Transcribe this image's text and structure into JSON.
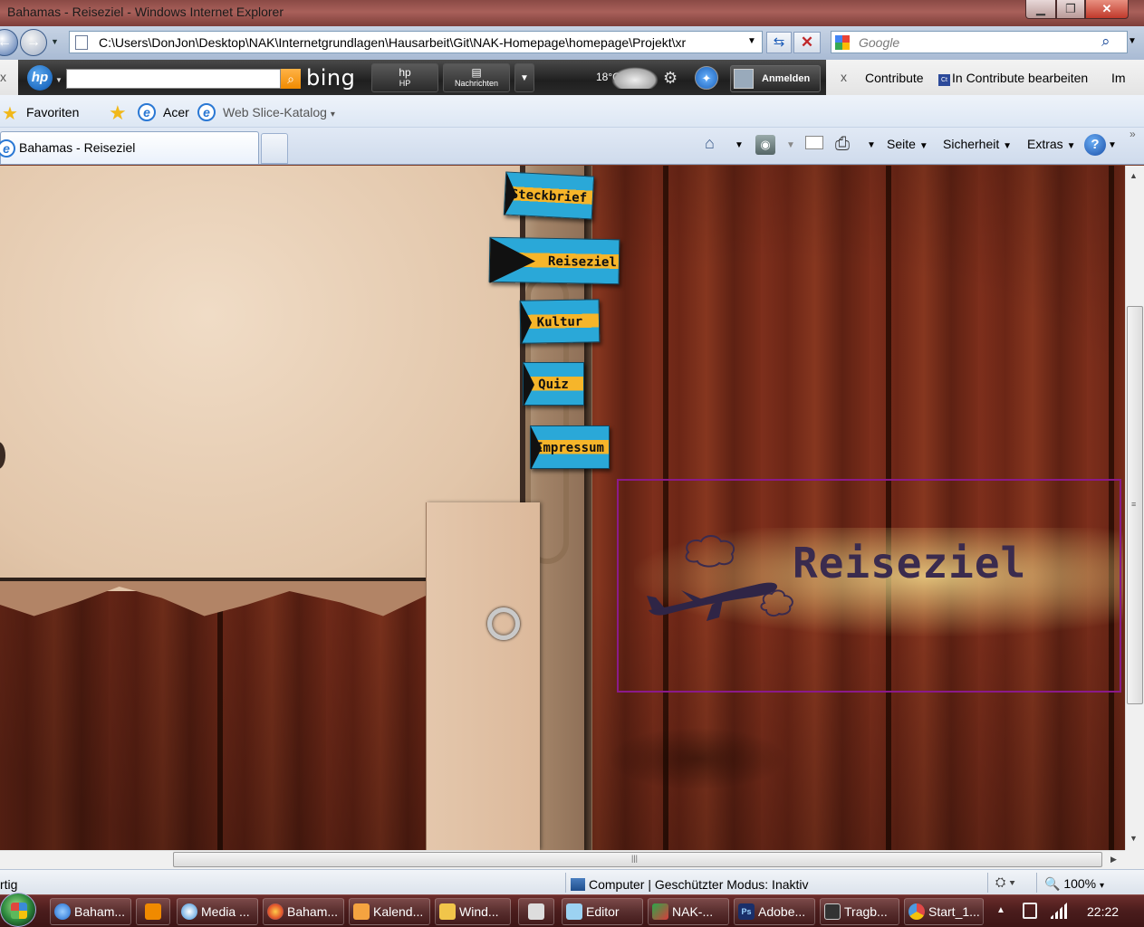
{
  "window": {
    "title": "Bahamas - Reiseziel - Windows Internet Explorer",
    "min_glyph": "▁",
    "max_glyph": "❐",
    "close_glyph": "✕"
  },
  "addressbar": {
    "back_glyph": "←",
    "forward_glyph": "→",
    "dropdown_glyph": "▼",
    "url": "C:\\Users\\DonJon\\Desktop\\NAK\\Internetgrundlagen\\Hausarbeit\\Git\\NAK-Homepage\\homepage\\Projekt\\xr",
    "refresh_glyph": "⇆",
    "stop_glyph": "✕",
    "search_placeholder": "Google",
    "search_glyph": "⌕"
  },
  "hp_toolbar": {
    "close_glyph": "x",
    "hp_logo": "hp",
    "search_go_glyph": "⌕",
    "bing_label": "bing",
    "hp_button": {
      "icon": "hp",
      "label": "HP"
    },
    "news_button": {
      "icon": "▤",
      "label": "Nachrichten"
    },
    "dropdown_glyph": "▼",
    "weather": "18°C",
    "gear_glyph": "⚙",
    "help_glyph": "✦",
    "login_label": "Anmelden"
  },
  "contribute": {
    "close_glyph": "x",
    "label": "Contribute",
    "edit_icon": "Ct",
    "edit_label": "In Contribute bearbeiten",
    "truncated_label": "Im"
  },
  "favorites_bar": {
    "star_glyph": "★",
    "favorites_label": "Favoriten",
    "add_glyph": "★",
    "ie_glyph": "e",
    "acer_label": "Acer",
    "webslice_label": "Web Slice-Katalog",
    "dropdown_glyph": "▾"
  },
  "tabs": {
    "active": {
      "label": "Bahamas - Reiseziel",
      "icon_glyph": "e"
    }
  },
  "command_bar": {
    "home_glyph": "⌂",
    "feeds_glyph": "◉",
    "print_glyph": "⎙",
    "caret": "▼",
    "seite_label": "Seite",
    "sicherheit_label": "Sicherheit",
    "extras_label": "Extras",
    "help_glyph": "?",
    "chevron_glyph": "»"
  },
  "page": {
    "nav_tabs": [
      {
        "label": "Steckbrief"
      },
      {
        "label": "Reiseziel"
      },
      {
        "label": "Kultur"
      },
      {
        "label": "Quiz"
      },
      {
        "label": "Impressum"
      }
    ],
    "heading": "Reiseziel"
  },
  "scrollbars": {
    "up_glyph": "▲",
    "down_glyph": "▼",
    "right_glyph": "▶",
    "grip_glyph": "≡",
    "hgrip_glyph": "|||"
  },
  "status": {
    "ready_text": "rtig",
    "zone_text": "Computer | Geschützter Modus: Inaktiv",
    "protected_glyph": "⛭ ▾",
    "zoom_glyph": "🔍",
    "zoom_text": "100%",
    "zoom_caret": "▾"
  },
  "taskbar": {
    "items": [
      {
        "label": "Baham..."
      },
      {
        "label": ""
      },
      {
        "label": "Media ..."
      },
      {
        "label": "Baham..."
      },
      {
        "label": "Kalend..."
      },
      {
        "label": "Wind..."
      },
      {
        "label": ""
      },
      {
        "label": "Editor"
      },
      {
        "label": "NAK-..."
      },
      {
        "label": "Adobe..."
      },
      {
        "label": "Tragb..."
      },
      {
        "label": "Start_1..."
      }
    ],
    "adobe_icon": "Ps",
    "tray_up_glyph": "▲",
    "clock": "22:22"
  }
}
